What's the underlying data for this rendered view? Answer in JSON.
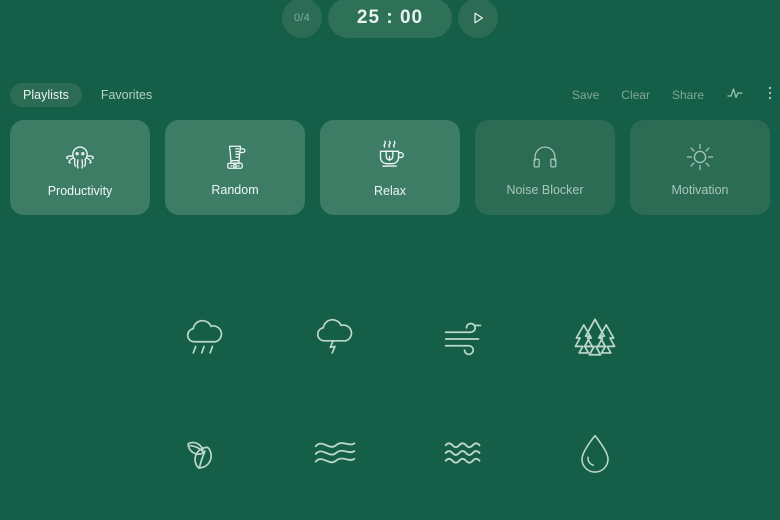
{
  "app": {
    "background_color": "#155e48",
    "card_color": "#2c6c55",
    "card_active_color": "#3d7d66",
    "accent_text_color": "#eaf5f0"
  },
  "timer": {
    "session_counter": "0/4",
    "time_display": "25 : 00",
    "play_icon": "play-icon"
  },
  "tabs": [
    {
      "label": "Playlists",
      "active": true
    },
    {
      "label": "Favorites",
      "active": false
    }
  ],
  "actions": [
    {
      "label": "Save"
    },
    {
      "label": "Clear"
    },
    {
      "label": "Share"
    }
  ],
  "action_icons": [
    {
      "name": "activity-waveform-icon"
    },
    {
      "name": "more-options-icon"
    }
  ],
  "playlists": [
    {
      "label": "Productivity",
      "icon": "octopus-icon",
      "active": true
    },
    {
      "label": "Random",
      "icon": "blender-icon",
      "active": true
    },
    {
      "label": "Relax",
      "icon": "teacup-icon",
      "active": true
    },
    {
      "label": "Noise Blocker",
      "icon": "headphones-icon",
      "active": false
    },
    {
      "label": "Motivation",
      "icon": "sun-icon",
      "active": false
    },
    {
      "label": "",
      "icon": "partial-card-icon",
      "active": false
    }
  ],
  "sounds": [
    {
      "name": "rain-cloud-icon",
      "label": "Rain"
    },
    {
      "name": "thunder-cloud-icon",
      "label": "Thunder"
    },
    {
      "name": "wind-icon",
      "label": "Wind"
    },
    {
      "name": "forest-trees-icon",
      "label": "Forest"
    },
    {
      "name": "leaves-icon",
      "label": "Leaves"
    },
    {
      "name": "wavy-lines-icon",
      "label": "Waves"
    },
    {
      "name": "water-ripples-icon",
      "label": "Water"
    },
    {
      "name": "water-droplet-icon",
      "label": "Droplet"
    }
  ]
}
